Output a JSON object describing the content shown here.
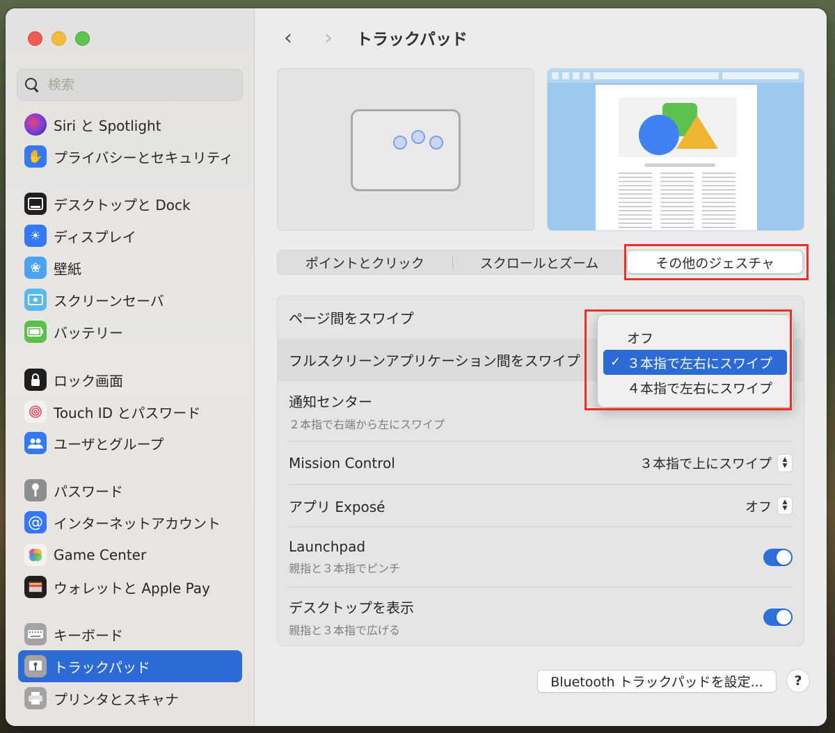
{
  "window": {
    "title": "トラックパッド"
  },
  "search": {
    "placeholder": "検索"
  },
  "sidebar": {
    "items": [
      {
        "label": "Siri と Spotlight",
        "icon": "siri-icon",
        "color": "#8a3fd1"
      },
      {
        "label": "プライバシーとセキュリティ",
        "icon": "hand-icon",
        "color": "#3478f6"
      },
      {
        "label": "デスクトップと Dock",
        "icon": "dock-icon",
        "color": "#1f1f1f"
      },
      {
        "label": "ディスプレイ",
        "icon": "sun-icon",
        "color": "#3478f6"
      },
      {
        "label": "壁紙",
        "icon": "flower-icon",
        "color": "#4ba3f2"
      },
      {
        "label": "スクリーンセーバ",
        "icon": "screensaver-icon",
        "color": "#5ab8f0"
      },
      {
        "label": "バッテリー",
        "icon": "battery-icon",
        "color": "#5ac04a"
      },
      {
        "label": "ロック画面",
        "icon": "lock-icon",
        "color": "#1f1f1f"
      },
      {
        "label": "Touch ID とパスワード",
        "icon": "fingerprint-icon",
        "color": "#f2f2f2"
      },
      {
        "label": "ユーザとグループ",
        "icon": "users-icon",
        "color": "#3478f6"
      },
      {
        "label": "パスワード",
        "icon": "key-icon",
        "color": "#8e8e8e"
      },
      {
        "label": "インターネットアカウント",
        "icon": "at-icon",
        "color": "#3478f6"
      },
      {
        "label": "Game Center",
        "icon": "gamecenter-icon",
        "color": "#f2f2f2"
      },
      {
        "label": "ウォレットと Apple Pay",
        "icon": "wallet-icon",
        "color": "#1f1f1f"
      },
      {
        "label": "キーボード",
        "icon": "keyboard-icon",
        "color": "#a3a3a3"
      },
      {
        "label": "トラックパッド",
        "icon": "trackpad-icon",
        "color": "#a3a3a3"
      },
      {
        "label": "プリンタとスキャナ",
        "icon": "printer-icon",
        "color": "#a3a3a3"
      }
    ]
  },
  "tabs": {
    "point_click": "ポイントとクリック",
    "scroll_zoom": "スクロールとズーム",
    "more_gestures": "その他のジェスチャ"
  },
  "settings": {
    "swipe_pages": {
      "label": "ページ間をスワイプ"
    },
    "swipe_fullscreen": {
      "label": "フルスクリーンアプリケーション間をスワイプ"
    },
    "notification_center": {
      "label": "通知センター",
      "sub": "２本指で右端から左にスワイプ"
    },
    "mission_control": {
      "label": "Mission Control",
      "value": "３本指で上にスワイプ"
    },
    "app_expose": {
      "label": "アプリ Exposé",
      "value": "オフ"
    },
    "launchpad": {
      "label": "Launchpad",
      "sub": "親指と３本指でピンチ",
      "enabled": true
    },
    "show_desktop": {
      "label": "デスクトップを表示",
      "sub": "親指と３本指で広げる",
      "enabled": true
    }
  },
  "popup": {
    "options": [
      {
        "label": "オフ",
        "selected": false
      },
      {
        "label": "３本指で左右にスワイプ",
        "selected": true
      },
      {
        "label": "４本指で左右にスワイプ",
        "selected": false
      }
    ],
    "check_glyph": "✓"
  },
  "buttons": {
    "bluetooth": "Bluetooth トラックパッドを設定...",
    "help": "?"
  },
  "colors": {
    "accent": "#2c6ad6",
    "highlight_box": "#e43324"
  }
}
